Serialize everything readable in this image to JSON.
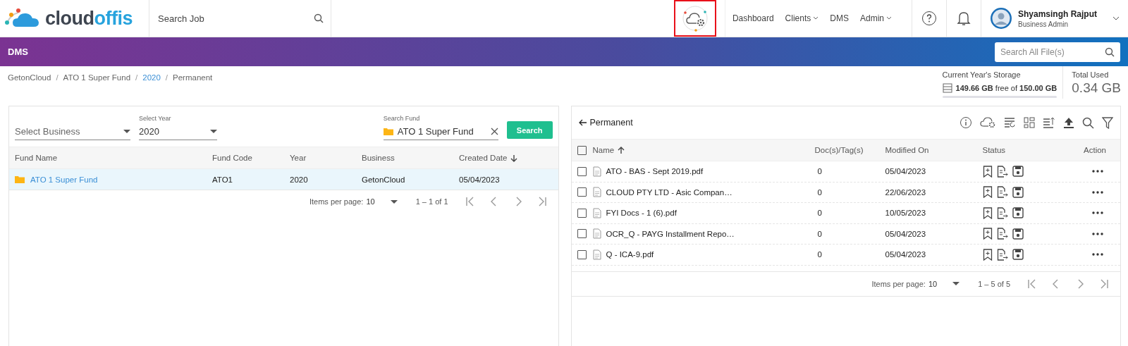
{
  "header": {
    "logo": {
      "dark": "cloud",
      "light": "offis"
    },
    "search_job": {
      "placeholder": "Search Job"
    },
    "cloud_settings_button": {
      "highlighted": true
    },
    "nav": [
      {
        "label": "Dashboard",
        "has_menu": false
      },
      {
        "label": "Clients",
        "has_menu": true
      },
      {
        "label": "DMS",
        "has_menu": false
      },
      {
        "label": "Admin",
        "has_menu": true
      }
    ],
    "user": {
      "name": "Shyamsingh Rajput",
      "role": "Business Admin"
    }
  },
  "banner": {
    "title": "DMS",
    "search": {
      "placeholder": "Search All File(s)"
    }
  },
  "breadcrumb": {
    "separator": "/",
    "items": [
      {
        "label": "GetonCloud",
        "link": false
      },
      {
        "label": "ATO 1 Super Fund",
        "link": false
      },
      {
        "label": "2020",
        "link": true
      },
      {
        "label": "Permanent",
        "link": false
      }
    ]
  },
  "storage": {
    "label": "Current Year's Storage",
    "free": "149.66 GB",
    "free_of": "free of",
    "total": "150.00 GB",
    "total_used_label": "Total Used",
    "total_used": "0.34 GB"
  },
  "fund_panel": {
    "filters": {
      "business": {
        "placeholder": "Select Business"
      },
      "year": {
        "label": "Select Year",
        "value": "2020"
      },
      "fund": {
        "label": "Search Fund",
        "value": "ATO 1 Super Fund"
      },
      "search_button": "Search"
    },
    "columns": [
      "Fund Name",
      "Fund Code",
      "Year",
      "Business",
      "Created Date"
    ],
    "rows": [
      {
        "selected": true,
        "cells": [
          "ATO 1 Super Fund",
          "ATO1",
          "2020",
          "GetonCloud",
          "05/04/2023"
        ]
      }
    ],
    "pagination": {
      "label": "Items per page:",
      "per_page": "10",
      "range": "1 – 1 of 1"
    }
  },
  "file_panel": {
    "title": "Permanent",
    "columns": [
      "Name",
      "Doc(s)/Tag(s)",
      "Modified On",
      "Status",
      "Action"
    ],
    "all_checked": false,
    "rows": [
      {
        "checked": false,
        "name": "ATO - BAS - Sept 2019.pdf",
        "docs": "0",
        "modified": "05/04/2023"
      },
      {
        "checked": false,
        "name": "CLOUD PTY LTD - Asic Compan…",
        "docs": "0",
        "modified": "22/06/2023"
      },
      {
        "checked": false,
        "name": "FYI Docs - 1 (6).pdf",
        "docs": "0",
        "modified": "10/05/2023"
      },
      {
        "checked": false,
        "name": "OCR_Q - PAYG Installment Repo…",
        "docs": "0",
        "modified": "05/04/2023"
      },
      {
        "checked": false,
        "name": "Q - ICA-9.pdf",
        "docs": "0",
        "modified": "05/04/2023"
      }
    ],
    "pagination": {
      "label": "Items per page:",
      "per_page": "10",
      "range": "1 – 5 of 5"
    }
  }
}
